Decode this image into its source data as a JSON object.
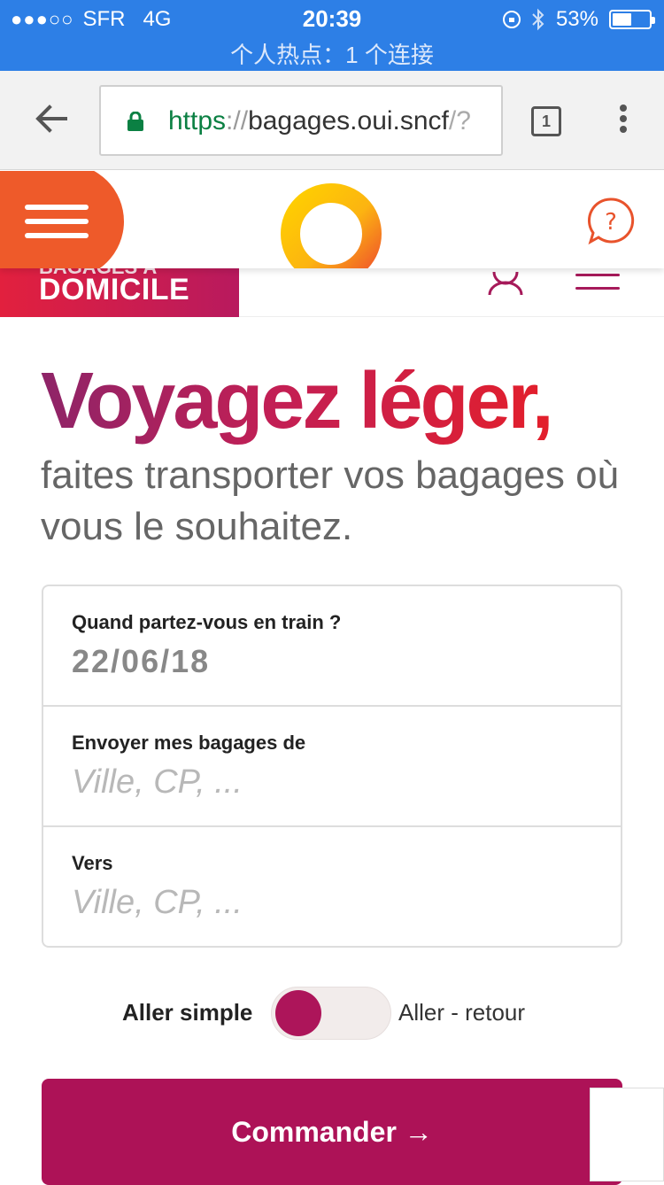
{
  "status_bar": {
    "carrier": "SFR",
    "network": "4G",
    "time": "20:39",
    "battery_percent": "53%",
    "battery_level": 0.53,
    "hotspot": "个人热点：1 个连接"
  },
  "browser": {
    "url_scheme": "https",
    "url_separator": "://",
    "url_host": "bagages.oui.sncf",
    "url_tail": "/?",
    "tab_count": "1"
  },
  "brand": {
    "badge_top": "BAGAGES À",
    "badge_text": "DOMICILE"
  },
  "hero": {
    "title": "Voyagez léger,",
    "subtitle": "faites transporter vos bagages où vous le souhaitez."
  },
  "form": {
    "date_label": "Quand partez-vous en train ?",
    "date_value": "22/06/18",
    "from_label": "Envoyer mes bagages de",
    "from_placeholder": "Ville, CP, ...",
    "to_label": "Vers",
    "to_placeholder": "Ville, CP, ..."
  },
  "trip": {
    "one_way": "Aller simple",
    "round_trip": "Aller - retour"
  },
  "cta": {
    "label": "Commander →"
  },
  "colors": {
    "status_bar": "#2d7fe6",
    "brand_orange": "#ee5a2a",
    "brand_magenta": "#ad1257",
    "url_green": "#0b8043"
  }
}
